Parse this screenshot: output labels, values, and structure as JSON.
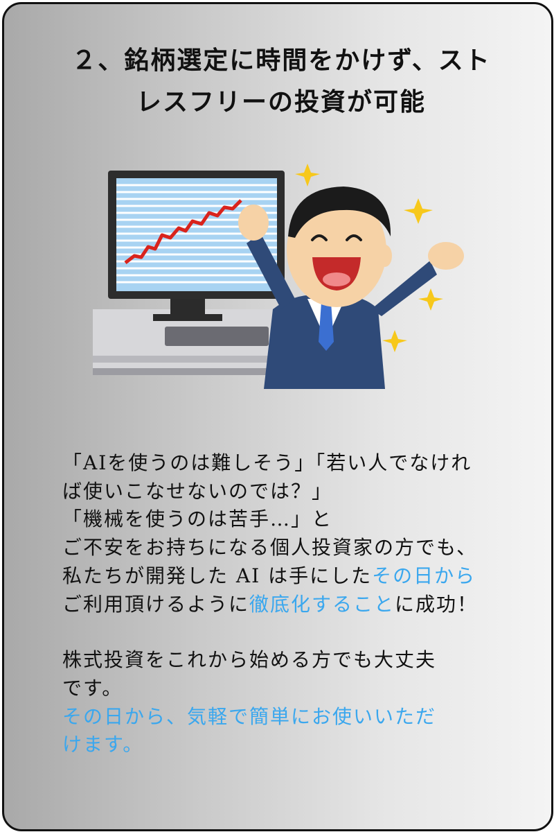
{
  "title": {
    "line1": "２、銘柄選定に時間をかけず、スト",
    "line2": "レスフリーの投資が可能"
  },
  "illustration": {
    "description_icon": "happy-investor-with-rising-chart-icon"
  },
  "paragraph1": {
    "line1": "「AIを使うのは難しそう」「若い人でなけれ",
    "line2": "ば使いこなせないのでは？」",
    "line3": "「機械を使うのは苦手…」と",
    "line4": "ご不安をお持ちになる個人投資家の方でも、",
    "line5_a": "私たちが開発した AI は手にした",
    "line5_b": "その日から",
    "line6_a": "ご利用頂けるように",
    "line6_b": "徹底化すること",
    "line6_c": "に成功！"
  },
  "paragraph2": {
    "line1": "株式投資をこれから始める方でも大丈夫",
    "line2": "です。",
    "line3": "その日から、気軽で簡単にお使いいただ",
    "line4": "けます。"
  },
  "colors": {
    "highlight": "#3aa7ee",
    "text": "#111111",
    "chart_line": "#d9231c",
    "suit": "#2f4a78"
  }
}
